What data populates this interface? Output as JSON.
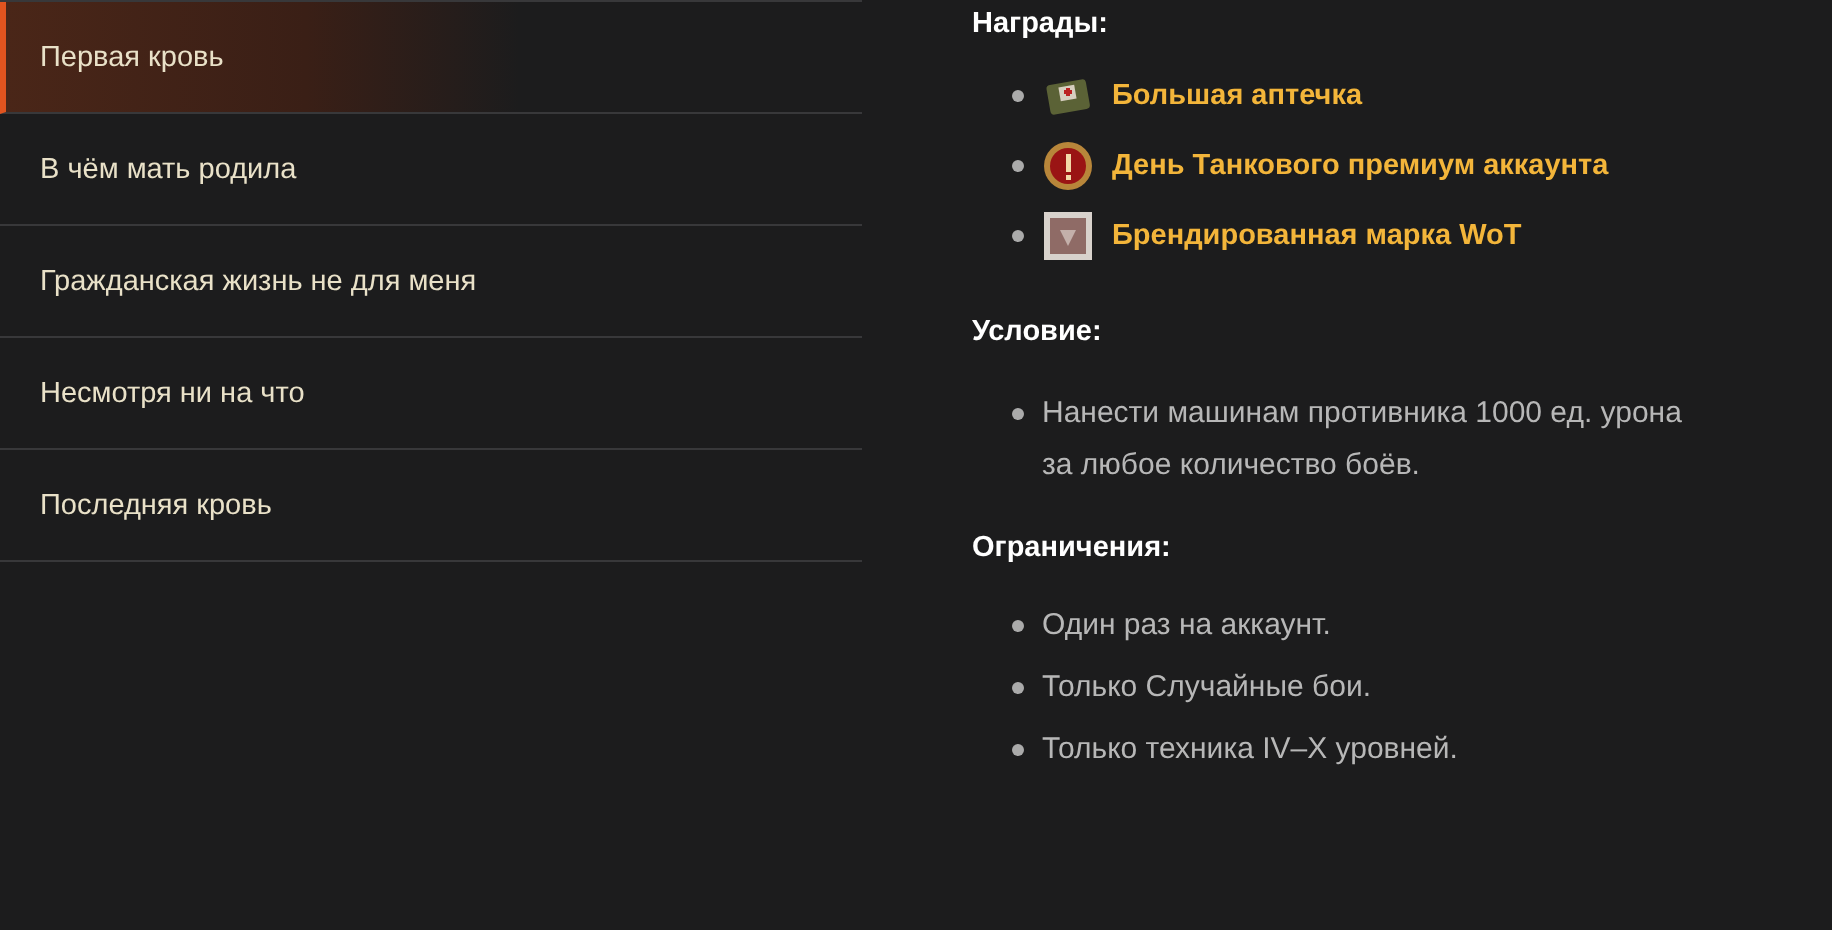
{
  "sidebar": {
    "items": [
      {
        "label": "Первая кровь",
        "selected": true
      },
      {
        "label": "В чём мать родила",
        "selected": false
      },
      {
        "label": "Гражданская жизнь не для меня",
        "selected": false
      },
      {
        "label": "Несмотря ни на что",
        "selected": false
      },
      {
        "label": "Последняя кровь",
        "selected": false
      }
    ]
  },
  "rewards": {
    "heading": "Награды:",
    "items": [
      {
        "kind": "medkit",
        "label": "Большая аптечка"
      },
      {
        "kind": "premium",
        "label": "День Танкового премиум аккаунта"
      },
      {
        "kind": "stamp",
        "label": "Брендированная марка WoT"
      }
    ]
  },
  "condition": {
    "heading": "Условие:",
    "items": [
      "Нанести машинам противника 1000 ед. урона за любое количество боёв."
    ]
  },
  "restrictions": {
    "heading": "Ограничения:",
    "items": [
      "Один раз на аккаунт.",
      "Только Случайные бои.",
      "Только техника IV–X уровней."
    ]
  }
}
